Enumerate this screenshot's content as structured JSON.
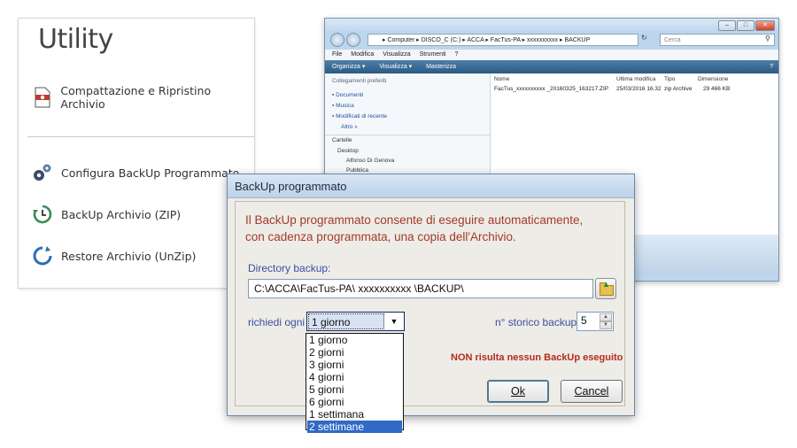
{
  "utility": {
    "title": "Utility",
    "items": [
      {
        "label": "Compattazione e Ripristino Archivio",
        "icon": "archive-repair-icon"
      },
      {
        "label": "Configura BackUp Programmato",
        "icon": "gears-icon"
      },
      {
        "label": "BackUp Archivio (ZIP)",
        "icon": "clock-backup-icon"
      },
      {
        "label": "Restore Archivio (UnZip)",
        "icon": "restore-arrow-icon"
      }
    ]
  },
  "explorer": {
    "address": "▸ Computer ▸ DISCO_C (C:) ▸ ACCA ▸ FacTus-PA ▸ xxxxxxxxxx ▸ BACKUP",
    "search_placeholder": "Cerca",
    "menu": [
      "File",
      "Modifica",
      "Visualizza",
      "Strumenti",
      "?"
    ],
    "toolbar": [
      "Organizza ▾",
      "Visualizza ▾",
      "Masterizza"
    ],
    "favorites_header": "Collegamenti preferiti",
    "favorites": [
      "Documenti",
      "Musica",
      "Modificati di recente",
      "Altro »"
    ],
    "folders_header": "Cartelle",
    "folders": [
      "Desktop",
      "Alfonso Di Genova",
      "Pubblica"
    ],
    "columns": [
      "Nome",
      "Ultima modifica",
      "Tipo",
      "Dimensione"
    ],
    "files": [
      {
        "name": "FacTus_xxxxxxxxxx _20160325_163217.ZIP",
        "modified": "25/03/2016 16.32",
        "type": "zip Archive",
        "size": "29 466 KB"
      }
    ]
  },
  "dialog": {
    "title": "BackUp programmato",
    "message_line1": "Il BackUp programmato consente di eseguire automaticamente,",
    "message_line2": "con cadenza programmata, una copia dell'Archivio.",
    "dir_label": "Directory backup:",
    "dir_value": "C:\\ACCA\\FacTus-PA\\ xxxxxxxxxx \\BACKUP\\",
    "every_label": "richiedi ogni",
    "every_value": "1 giorno",
    "storico_label": "n° storico backup",
    "storico_value": "5",
    "status": "NON risulta nessun BackUp eseguito",
    "ok_label": "Ok",
    "cancel_label": "Cancel",
    "options": [
      "1 giorno",
      "2 giorni",
      "3 giorni",
      "4 giorni",
      "5 giorni",
      "6 giorni",
      "1 settimana",
      "2 settimane"
    ],
    "highlighted_option": "2 settimane"
  }
}
